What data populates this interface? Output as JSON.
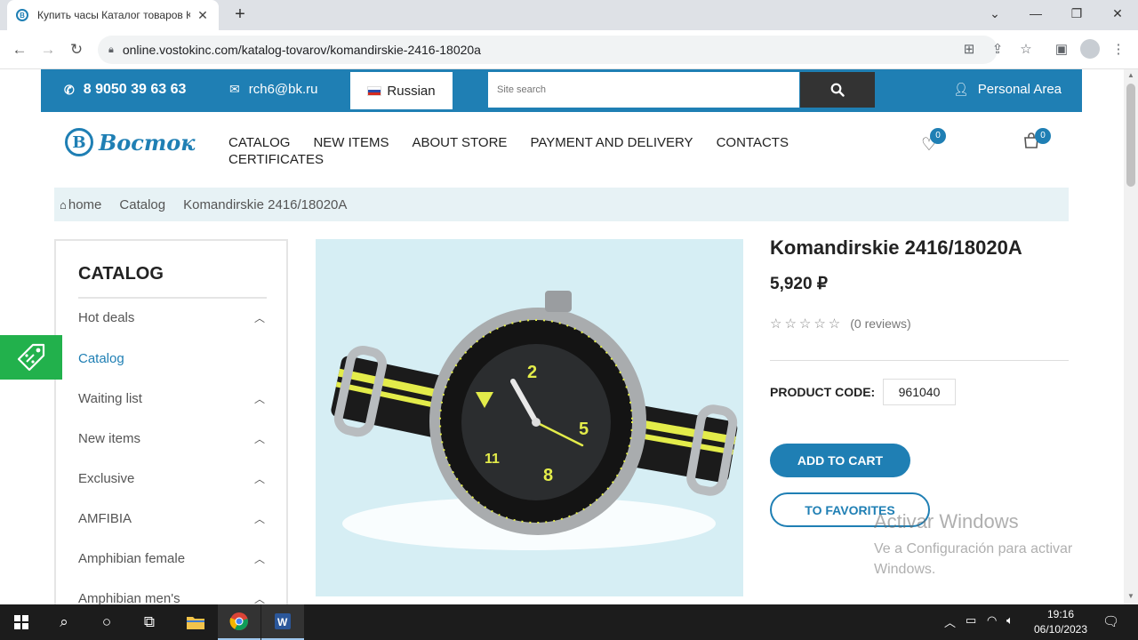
{
  "browser": {
    "tab_title": "Купить часы Каталог товаров К",
    "tab_close": "✕",
    "new_tab": "+",
    "url": "online.vostokinc.com/katalog-tovarov/komandirskie-2416-18020a",
    "window_controls": [
      "⌄",
      "—",
      "❐",
      "✕"
    ]
  },
  "topbar": {
    "phone": "8 9050 39 63 63",
    "email": "rch6@bk.ru",
    "language": "Russian",
    "search_placeholder": "Site search",
    "personal_area": "Personal Area"
  },
  "header": {
    "logo_text": "Восток",
    "nav": [
      "CATALOG",
      "NEW ITEMS",
      "ABOUT STORE",
      "PAYMENT AND DELIVERY",
      "CONTACTS",
      "CERTIFICATES"
    ],
    "favorites_count": "0",
    "cart_count": "0"
  },
  "breadcrumb": [
    "home",
    "Catalog",
    "Komandirskie 2416/18020A"
  ],
  "sidebar": {
    "title": "CATALOG",
    "items": [
      {
        "label": "Hot deals",
        "has_chevron": true
      },
      {
        "label": "Catalog",
        "has_chevron": false
      },
      {
        "label": "Waiting list",
        "has_chevron": true
      },
      {
        "label": "New items",
        "has_chevron": true
      },
      {
        "label": "Exclusive",
        "has_chevron": true
      },
      {
        "label": "AMFIBIA",
        "has_chevron": true
      },
      {
        "label": "Amphibian female",
        "has_chevron": true
      },
      {
        "label": "Amphibian men's",
        "has_chevron": true
      }
    ]
  },
  "product": {
    "title": "Komandirskie 2416/18020A",
    "price": "5,920 ₽",
    "stars": "☆☆☆☆☆",
    "reviews": "(0 reviews)",
    "code_label": "PRODUCT CODE:",
    "code_value": "961040",
    "add_to_cart": "ADD TO CART",
    "to_favorites": "TO FAVORITES"
  },
  "watermark": {
    "line1": "Activar Windows",
    "line2": "Ve a Configuración para activar Windows."
  },
  "taskbar": {
    "time": "19:16",
    "date": "06/10/2023"
  },
  "colors": {
    "brand_blue": "#1f7fb4",
    "promo_green": "#22b14c",
    "breadcrumb_bg": "#e7f2f5"
  }
}
